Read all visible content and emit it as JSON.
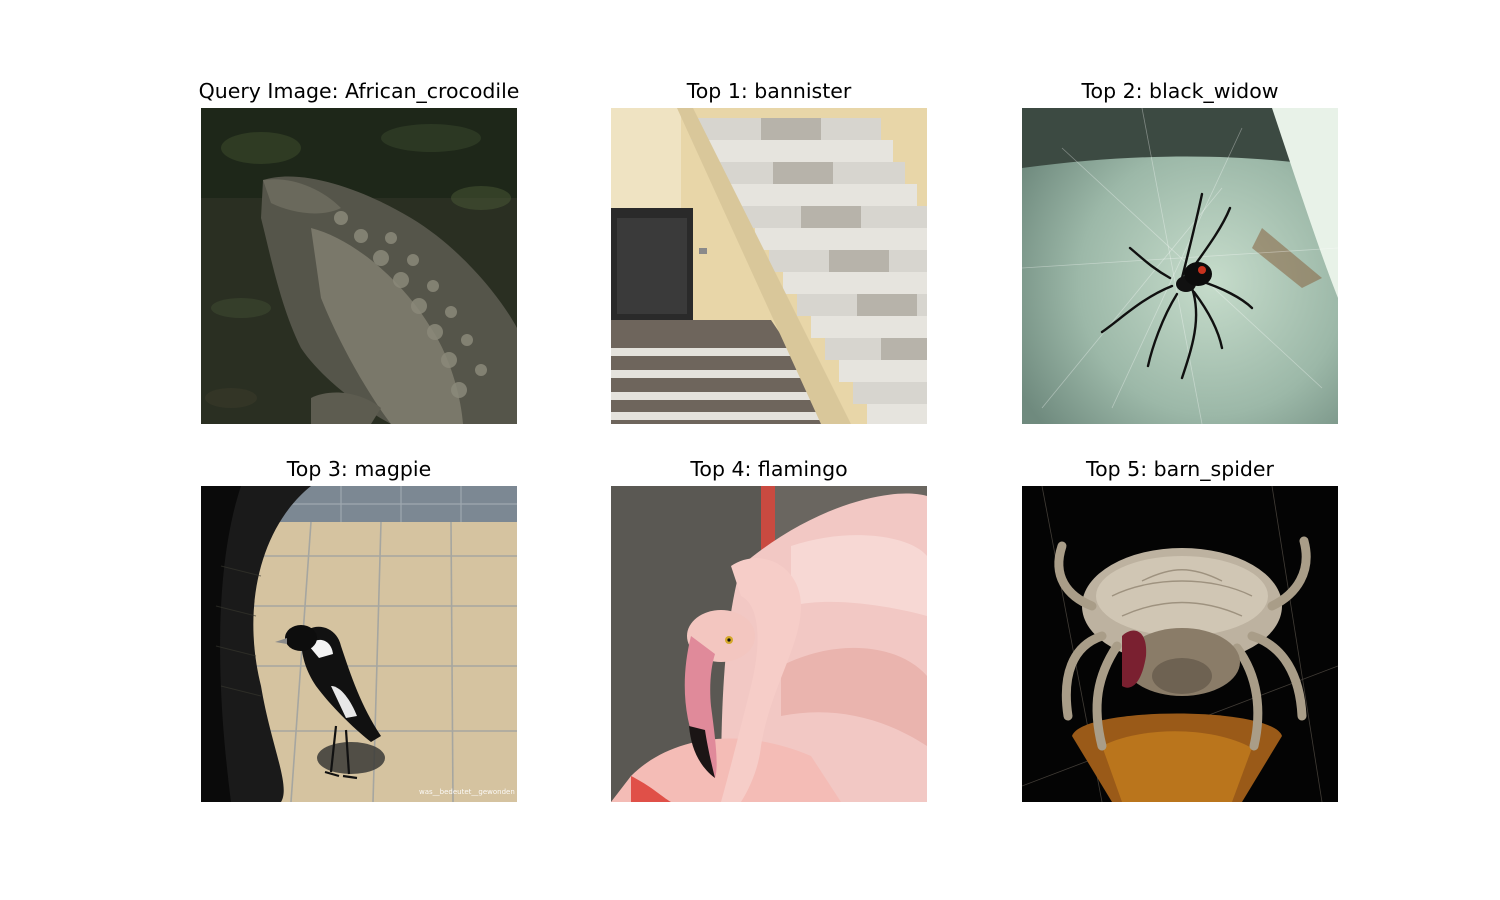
{
  "panels": [
    {
      "title": "Query Image: African_crocodile",
      "subject": "african-crocodile"
    },
    {
      "title": "Top 1: bannister",
      "subject": "bannister"
    },
    {
      "title": "Top 2: black_widow",
      "subject": "black-widow"
    },
    {
      "title": "Top 3: magpie",
      "subject": "magpie"
    },
    {
      "title": "Top 4: flamingo",
      "subject": "flamingo"
    },
    {
      "title": "Top 5: barn_spider",
      "subject": "barn-spider"
    }
  ],
  "watermark_text": "was__bedeutet__gewonden"
}
